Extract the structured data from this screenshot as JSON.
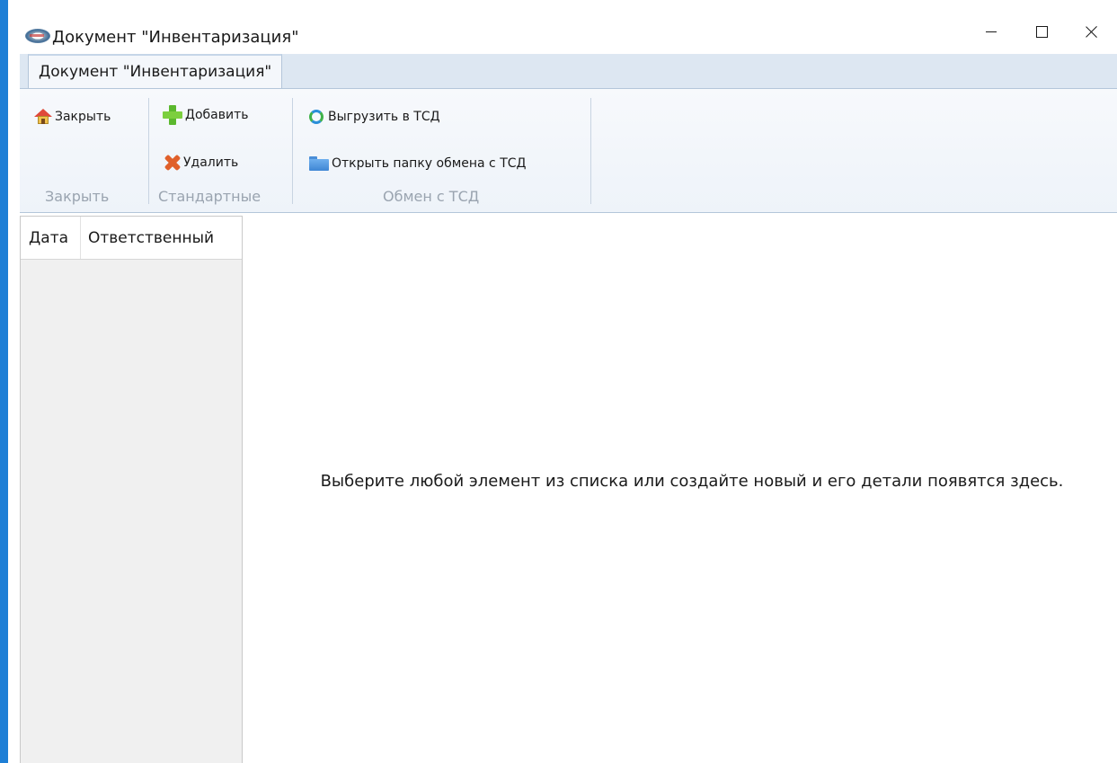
{
  "window": {
    "title": "Документ \"Инвентаризация\"",
    "icon": "app-logo-icon",
    "controls": [
      "minimize-icon",
      "maximize-icon",
      "close-icon"
    ]
  },
  "tabs": [
    {
      "label": "Документ \"Инвентаризация\"",
      "active": true
    }
  ],
  "ribbon": {
    "groups": [
      {
        "label": "Закрыть",
        "buttons": [
          {
            "label": "Закрыть",
            "icon": "home-icon"
          }
        ]
      },
      {
        "label": "Стандартные",
        "buttons": [
          {
            "label": "Добавить",
            "icon": "plus-icon"
          },
          {
            "label": "Удалить",
            "icon": "delete-x-icon"
          }
        ]
      },
      {
        "label": "Обмен с ТСД",
        "buttons": [
          {
            "label": "Выгрузить в ТСД",
            "icon": "sync-icon"
          },
          {
            "label": "Открыть папку обмена с ТСД",
            "icon": "folder-icon"
          }
        ]
      }
    ]
  },
  "list": {
    "columns": [
      "Дата",
      "Ответственный"
    ],
    "rows": []
  },
  "details": {
    "empty_message": "Выберите любой элемент из списка или создайте новый и его детали появятся здесь."
  },
  "colors": {
    "accent": "#1e7fd6",
    "ribbon_bg": "#eef3f9",
    "tabstrip_bg": "#dde7f2",
    "group_label": "#9aa4b0",
    "list_bg": "#f0f0f0"
  }
}
